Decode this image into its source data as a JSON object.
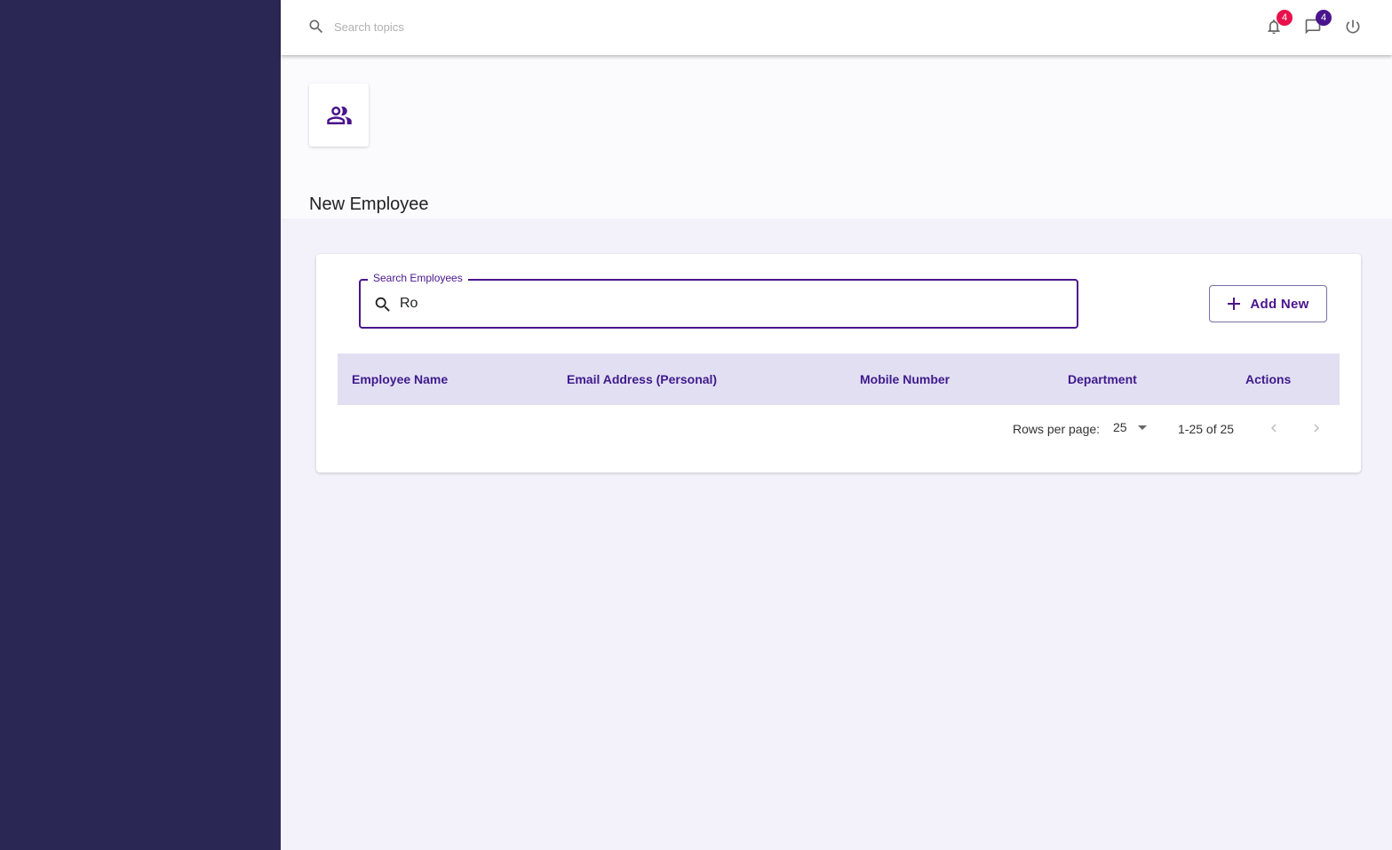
{
  "topbar": {
    "search_placeholder": "Search topics",
    "notifications_count": "4",
    "messages_count": "4"
  },
  "page": {
    "title": "New Employee"
  },
  "search": {
    "legend": "Search Employees",
    "value": "Ro"
  },
  "actions": {
    "add_new_label": "Add New"
  },
  "table": {
    "columns": [
      "Employee Name",
      "Email Address (Personal)",
      "Mobile Number",
      "Department",
      "Actions"
    ],
    "rows": []
  },
  "pagination": {
    "rows_per_page_label": "Rows per page:",
    "rows_per_page_value": "25",
    "range": "1-25 of 25"
  },
  "colors": {
    "sidebar": "#2b2755",
    "accent": "#4a148c",
    "notification_badge": "#e8114b",
    "message_badge": "#4a148c",
    "table_header_bg": "#e2dff2"
  },
  "icons": {
    "topbar_search": "search-icon",
    "notifications": "bell-icon",
    "messages": "chat-icon",
    "power": "power-icon",
    "tile": "people-icon",
    "field_search": "search-icon",
    "add": "plus-icon",
    "prev": "chevron-left-icon",
    "next": "chevron-right-icon"
  }
}
